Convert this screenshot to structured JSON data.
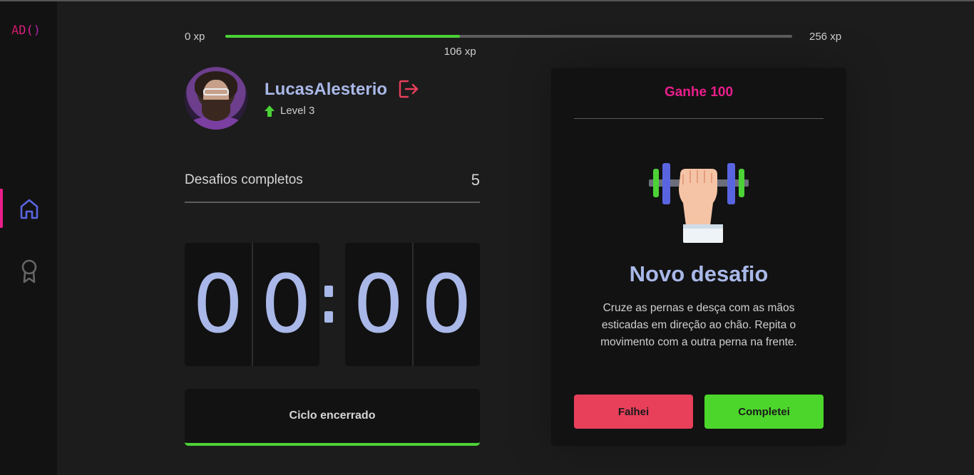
{
  "brand": {
    "logo": "AD()"
  },
  "nav": {
    "items": [
      {
        "icon": "home-icon",
        "active": true
      },
      {
        "icon": "award-icon",
        "active": false
      }
    ]
  },
  "xp": {
    "min_label": "0 xp",
    "max_label": "256 xp",
    "current_label": "106 xp",
    "current": 106,
    "max": 256
  },
  "profile": {
    "username": "LucasAlesterio",
    "level_label": "Level 3"
  },
  "completed": {
    "label": "Desafios completos",
    "value": "5"
  },
  "countdown": {
    "minute_left": "0",
    "minute_right": "0",
    "second_left": "0",
    "second_right": "0"
  },
  "cycle": {
    "button_label": "Ciclo encerrado"
  },
  "challenge": {
    "header": "Ganhe 100",
    "title": "Novo desafio",
    "description": "Cruze as pernas e desça com as mãos esticadas em direção ao chão. Repita o movimento com a outra perna na frente.",
    "fail_label": "Falhei",
    "success_label": "Completei"
  },
  "colors": {
    "accent": "#e91e8c",
    "blue_text": "#a9b8e8",
    "green": "#4cd137",
    "red": "#e83f5b"
  }
}
